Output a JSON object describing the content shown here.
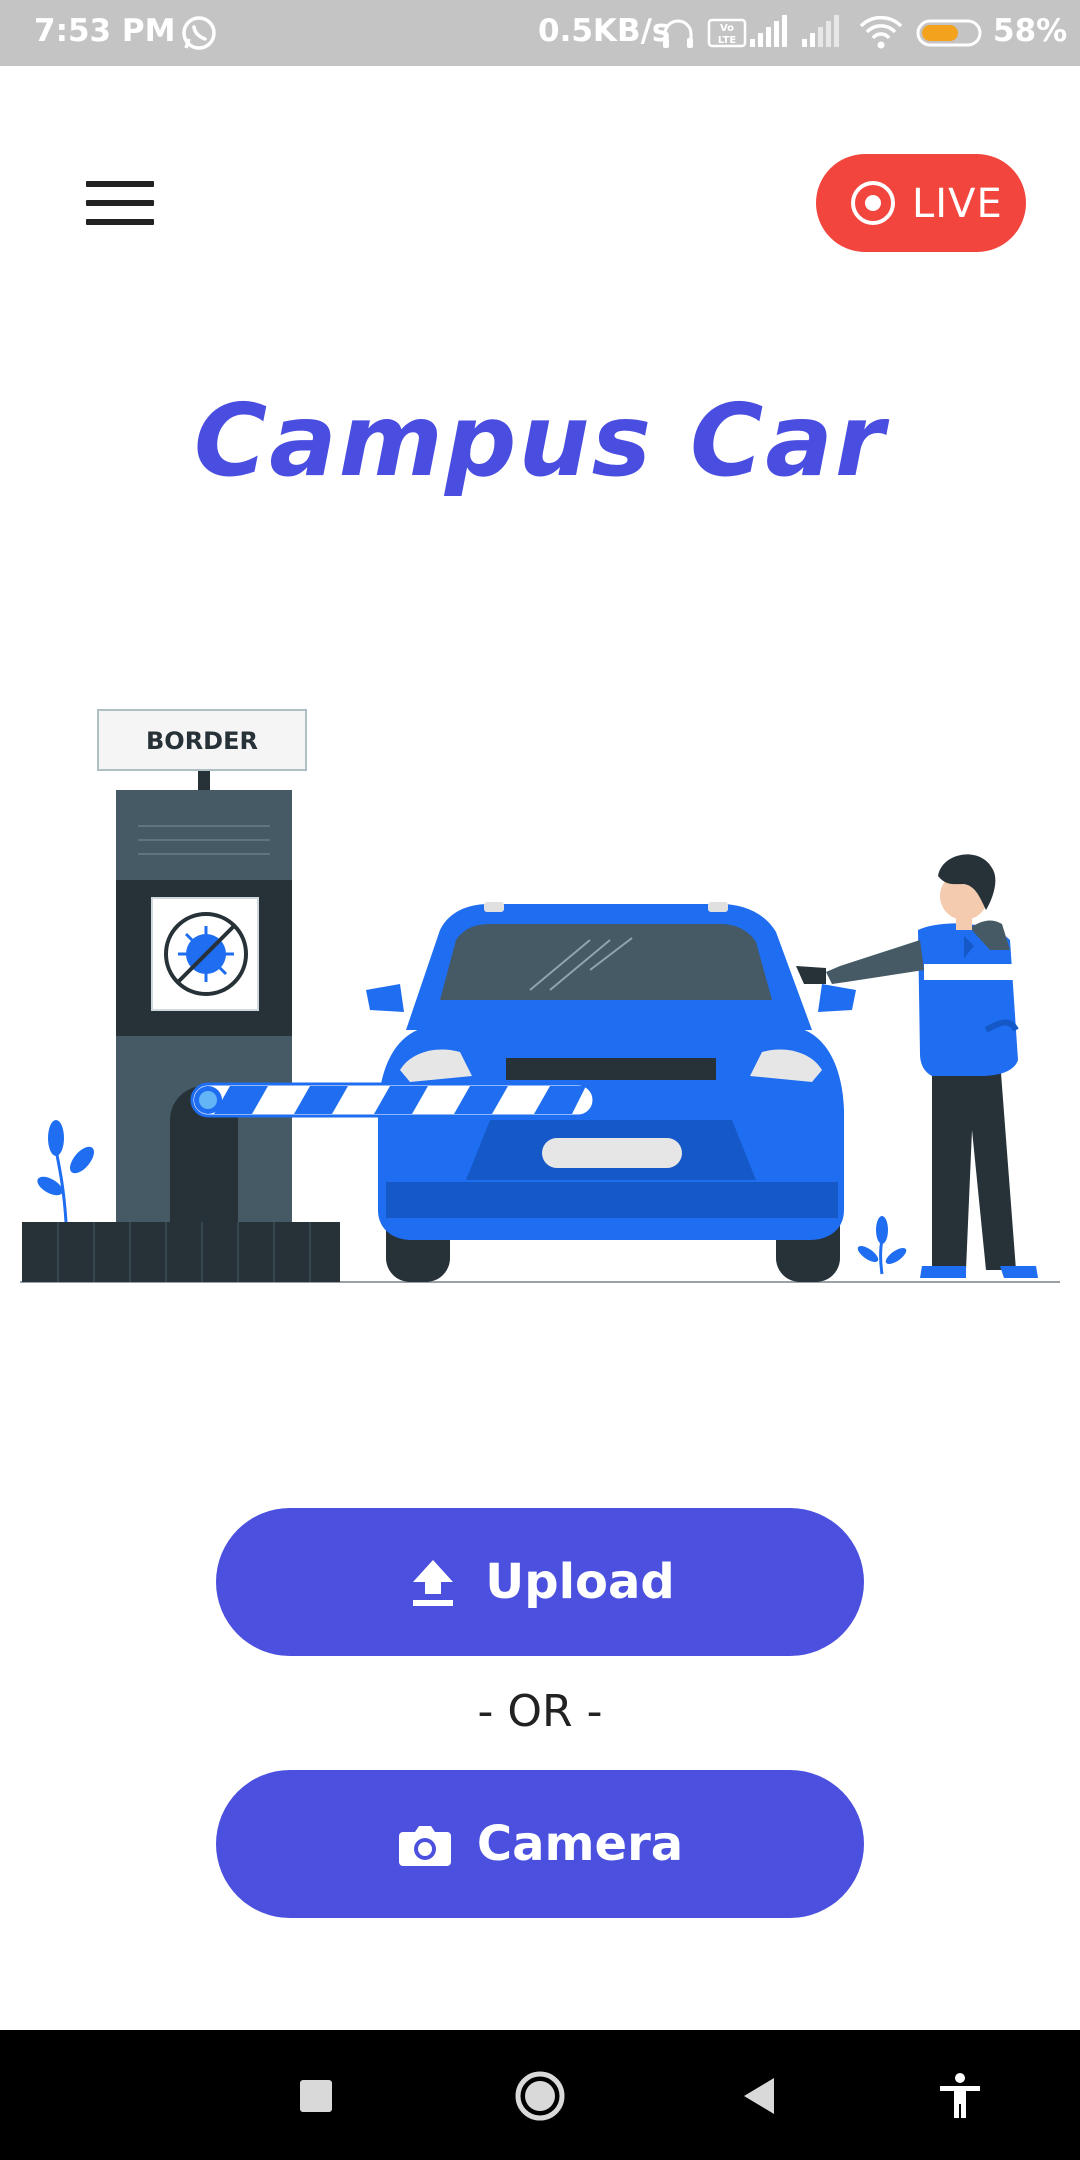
{
  "status_bar": {
    "time": "7:53 PM",
    "network_speed": "0.5KB/s",
    "battery_percent": "58%",
    "battery_level": 0.58,
    "icons": [
      "whatsapp-icon",
      "headphones-icon",
      "volte-icon",
      "signal-icon",
      "signal-icon",
      "wifi-icon",
      "battery-icon"
    ]
  },
  "header": {
    "menu_icon": "hamburger-menu-icon",
    "live_label": "LIVE",
    "live_icon": "record-icon",
    "live_color": "#f1453d"
  },
  "title": "Campus Car",
  "illustration": {
    "sign_text": "BORDER",
    "description_icon": "border-checkpoint-illustration"
  },
  "actions": {
    "upload_label": "Upload",
    "upload_icon": "upload-icon",
    "divider": "- OR -",
    "camera_label": "Camera",
    "camera_icon": "camera-icon",
    "button_color": "#4b51de"
  },
  "nav_bar": {
    "items": [
      "recents-square-icon",
      "home-circle-icon",
      "back-triangle-icon",
      "accessibility-icon"
    ]
  },
  "colors": {
    "title": "#4a4ee0",
    "accent_blue": "#1f6df0"
  }
}
